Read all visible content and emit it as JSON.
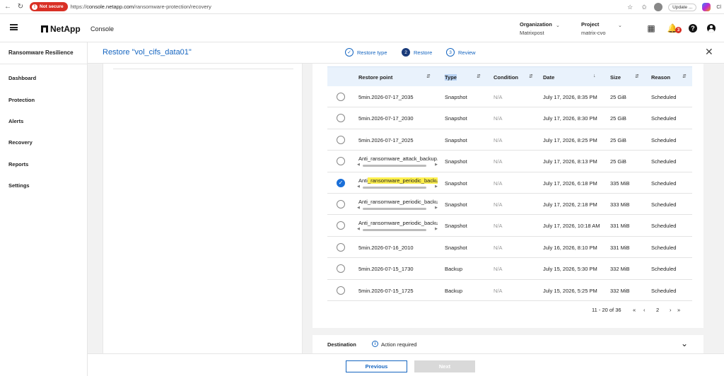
{
  "browser": {
    "security_label": "Not secure",
    "url_scheme": "https://",
    "url_host": "console.netapp.com",
    "url_path": "/ransomware-protection/recovery",
    "update_label": "Update",
    "update_more": "...",
    "edge_label": "Cl"
  },
  "header": {
    "logo_text": "NetApp",
    "console_label": "Console",
    "organization_label": "Organization",
    "organization_value": "Matrixpost",
    "project_label": "Project",
    "project_value": "matrix-cvo",
    "notification_count": "3",
    "help_glyph": "?"
  },
  "sidebar": {
    "title": "Ransomware Resilience",
    "items": [
      "Dashboard",
      "Protection",
      "Alerts",
      "Recovery",
      "Reports",
      "Settings"
    ]
  },
  "restore": {
    "title": "Restore \"vol_cifs_data01\"",
    "steps": [
      {
        "num": "✓",
        "label": "Restore type",
        "state": "done"
      },
      {
        "num": "2",
        "label": "Restore",
        "state": "active"
      },
      {
        "num": "3",
        "label": "Review",
        "state": "todo"
      }
    ]
  },
  "table": {
    "columns": [
      "Restore point",
      "Type",
      "Condition",
      "Date",
      "Size",
      "Reason"
    ],
    "rows": [
      {
        "name": "5min.2026-07-17_2035",
        "type": "Snapshot",
        "condition": "N/A",
        "date": "July 17, 2026, 8:35 PM",
        "size": "25 GiB",
        "reason": "Scheduled",
        "selected": false,
        "scroll": false
      },
      {
        "name": "5min.2026-07-17_2030",
        "type": "Snapshot",
        "condition": "N/A",
        "date": "July 17, 2026, 8:30 PM",
        "size": "25 GiB",
        "reason": "Scheduled",
        "selected": false,
        "scroll": false
      },
      {
        "name": "5min.2026-07-17_2025",
        "type": "Snapshot",
        "condition": "N/A",
        "date": "July 17, 2026, 8:25 PM",
        "size": "25 GiB",
        "reason": "Scheduled",
        "selected": false,
        "scroll": false
      },
      {
        "name": "Anti_ransomware_attack_backup.",
        "type": "Snapshot",
        "condition": "N/A",
        "date": "July 17, 2026, 8:13 PM",
        "size": "25 GiB",
        "reason": "Scheduled",
        "selected": false,
        "scroll": true
      },
      {
        "name": "Anti_ransomware_periodic_backu",
        "type": "Snapshot",
        "condition": "N/A",
        "date": "July 17, 2026, 6:18 PM",
        "size": "335 MiB",
        "reason": "Scheduled",
        "selected": true,
        "scroll": true,
        "highlight": true
      },
      {
        "name": "Anti_ransomware_periodic_backu",
        "type": "Snapshot",
        "condition": "N/A",
        "date": "July 17, 2026, 2:18 PM",
        "size": "333 MiB",
        "reason": "Scheduled",
        "selected": false,
        "scroll": true
      },
      {
        "name": "Anti_ransomware_periodic_backu",
        "type": "Snapshot",
        "condition": "N/A",
        "date": "July 17, 2026, 10:18 AM",
        "size": "331 MiB",
        "reason": "Scheduled",
        "selected": false,
        "scroll": true
      },
      {
        "name": "5min.2026-07-16_2010",
        "type": "Snapshot",
        "condition": "N/A",
        "date": "July 16, 2026, 8:10 PM",
        "size": "331 MiB",
        "reason": "Scheduled",
        "selected": false,
        "scroll": false
      },
      {
        "name": "5min.2026-07-15_1730",
        "type": "Backup",
        "condition": "N/A",
        "date": "July 15, 2026, 5:30 PM",
        "size": "332 MiB",
        "reason": "Scheduled",
        "selected": false,
        "scroll": false
      },
      {
        "name": "5min.2026-07-15_1725",
        "type": "Backup",
        "condition": "N/A",
        "date": "July 15, 2026, 5:25 PM",
        "size": "332 MiB",
        "reason": "Scheduled",
        "selected": false,
        "scroll": false
      }
    ]
  },
  "pagination": {
    "range": "11 - 20 of 36",
    "first": "«",
    "prev": "‹",
    "page": "2",
    "next": "›",
    "last": "»"
  },
  "destination": {
    "label": "Destination",
    "status": "Action required"
  },
  "footer": {
    "previous_label": "Previous",
    "next_label": "Next"
  },
  "colors": {
    "accent": "#1565c0",
    "selected": "#1a6fd8",
    "highlight": "#fff04d",
    "table_header": "#e9f2fc"
  }
}
